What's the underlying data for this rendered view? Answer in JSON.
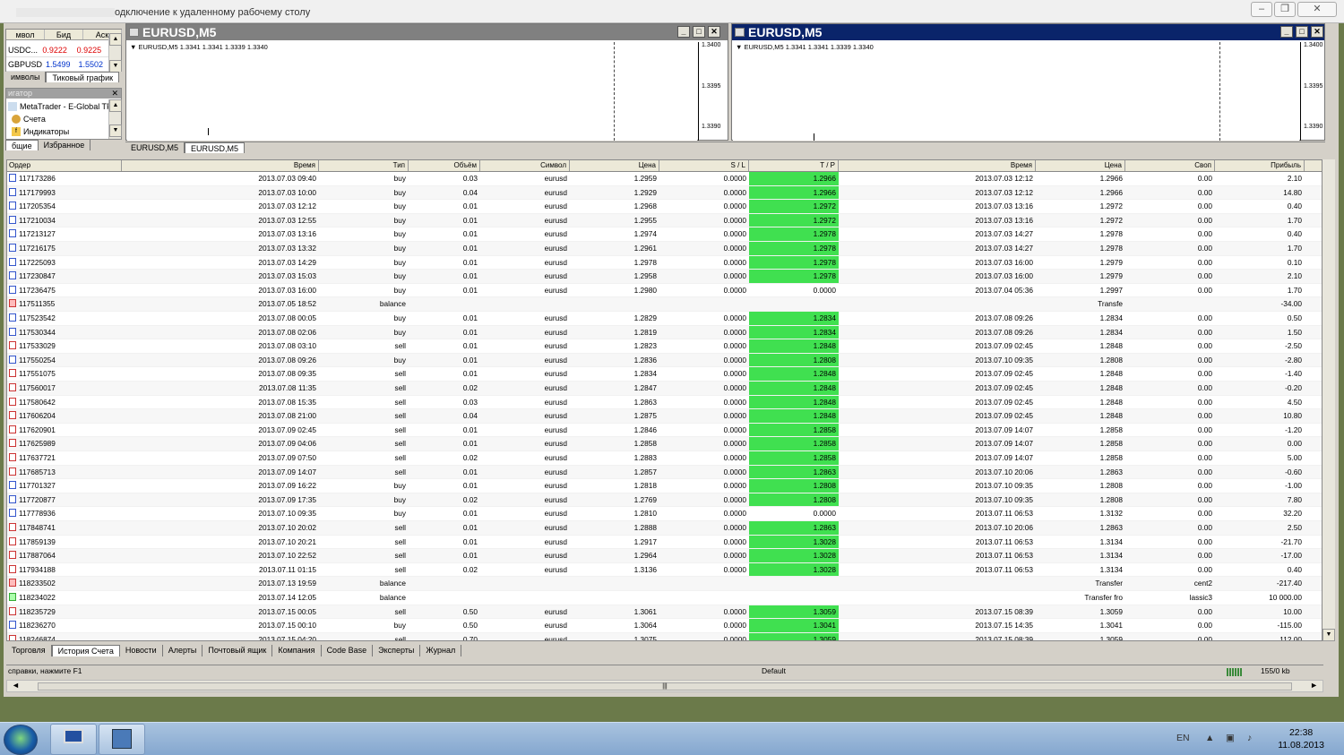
{
  "rdp": {
    "title": "одключение к удаленному рабочему столу"
  },
  "market_watch": {
    "headers": [
      "мвол",
      "Бид",
      "Аск"
    ],
    "rows": [
      {
        "symbol": "USDC...",
        "bid": "0.9222",
        "ask": "0.9225"
      },
      {
        "symbol": "GBPUSD",
        "bid": "1.5499",
        "ask": "1.5502"
      }
    ],
    "tabs": [
      "имволы",
      "Тиковый график"
    ]
  },
  "navigator": {
    "title": "игатор",
    "items": [
      "MetaTrader - E-Global TFG",
      "Счета",
      "Индикаторы"
    ],
    "tabs": [
      "бщие",
      "Избранное"
    ]
  },
  "charts": [
    {
      "title": "EURUSD,M5",
      "ohlc": "EURUSD,M5  1.3341 1.3341 1.3339 1.3340",
      "axis": [
        "1.3400",
        "1.3395",
        "1.3390"
      ]
    },
    {
      "title": "EURUSD,M5",
      "ohlc": "EURUSD,M5  1.3341 1.3341 1.3339 1.3340",
      "axis": [
        "1.3400",
        "1.3395",
        "1.3390"
      ]
    }
  ],
  "chart_tabs": [
    "EURUSD,M5",
    "EURUSD,M5"
  ],
  "table": {
    "headers": [
      "Ордер",
      "Время",
      "Тип",
      "Объём",
      "Символ",
      "Цена",
      "S / L",
      "T / P",
      "Время",
      "Цена",
      "Своп",
      "Прибыль"
    ],
    "rows": [
      [
        "117173286",
        "2013.07.03 09:40",
        "buy",
        "0.03",
        "eurusd",
        "1.2959",
        "0.0000",
        "1.2966",
        "2013.07.03 12:12",
        "1.2966",
        "0.00",
        "2.10"
      ],
      [
        "117179993",
        "2013.07.03 10:00",
        "buy",
        "0.04",
        "eurusd",
        "1.2929",
        "0.0000",
        "1.2966",
        "2013.07.03 12:12",
        "1.2966",
        "0.00",
        "14.80"
      ],
      [
        "117205354",
        "2013.07.03 12:12",
        "buy",
        "0.01",
        "eurusd",
        "1.2968",
        "0.0000",
        "1.2972",
        "2013.07.03 13:16",
        "1.2972",
        "0.00",
        "0.40"
      ],
      [
        "117210034",
        "2013.07.03 12:55",
        "buy",
        "0.01",
        "eurusd",
        "1.2955",
        "0.0000",
        "1.2972",
        "2013.07.03 13:16",
        "1.2972",
        "0.00",
        "1.70"
      ],
      [
        "117213127",
        "2013.07.03 13:16",
        "buy",
        "0.01",
        "eurusd",
        "1.2974",
        "0.0000",
        "1.2978",
        "2013.07.03 14:27",
        "1.2978",
        "0.00",
        "0.40"
      ],
      [
        "117216175",
        "2013.07.03 13:32",
        "buy",
        "0.01",
        "eurusd",
        "1.2961",
        "0.0000",
        "1.2978",
        "2013.07.03 14:27",
        "1.2978",
        "0.00",
        "1.70"
      ],
      [
        "117225093",
        "2013.07.03 14:29",
        "buy",
        "0.01",
        "eurusd",
        "1.2978",
        "0.0000",
        "1.2978",
        "2013.07.03 16:00",
        "1.2979",
        "0.00",
        "0.10"
      ],
      [
        "117230847",
        "2013.07.03 15:03",
        "buy",
        "0.01",
        "eurusd",
        "1.2958",
        "0.0000",
        "1.2978",
        "2013.07.03 16:00",
        "1.2979",
        "0.00",
        "2.10"
      ],
      [
        "117236475",
        "2013.07.03 16:00",
        "buy",
        "0.01",
        "eurusd",
        "1.2980",
        "0.0000",
        "0.0000",
        "2013.07.04 05:36",
        "1.2997",
        "0.00",
        "1.70"
      ],
      [
        "117511355",
        "2013.07.05 18:52",
        "balance",
        "",
        "",
        "",
        "",
        "",
        "",
        "Transfe",
        "",
        "-34.00"
      ],
      [
        "117523542",
        "2013.07.08 00:05",
        "buy",
        "0.01",
        "eurusd",
        "1.2829",
        "0.0000",
        "1.2834",
        "2013.07.08 09:26",
        "1.2834",
        "0.00",
        "0.50"
      ],
      [
        "117530344",
        "2013.07.08 02:06",
        "buy",
        "0.01",
        "eurusd",
        "1.2819",
        "0.0000",
        "1.2834",
        "2013.07.08 09:26",
        "1.2834",
        "0.00",
        "1.50"
      ],
      [
        "117533029",
        "2013.07.08 03:10",
        "sell",
        "0.01",
        "eurusd",
        "1.2823",
        "0.0000",
        "1.2848",
        "2013.07.09 02:45",
        "1.2848",
        "0.00",
        "-2.50"
      ],
      [
        "117550254",
        "2013.07.08 09:26",
        "buy",
        "0.01",
        "eurusd",
        "1.2836",
        "0.0000",
        "1.2808",
        "2013.07.10 09:35",
        "1.2808",
        "0.00",
        "-2.80"
      ],
      [
        "117551075",
        "2013.07.08 09:35",
        "sell",
        "0.01",
        "eurusd",
        "1.2834",
        "0.0000",
        "1.2848",
        "2013.07.09 02:45",
        "1.2848",
        "0.00",
        "-1.40"
      ],
      [
        "117560017",
        "2013.07.08 11:35",
        "sell",
        "0.02",
        "eurusd",
        "1.2847",
        "0.0000",
        "1.2848",
        "2013.07.09 02:45",
        "1.2848",
        "0.00",
        "-0.20"
      ],
      [
        "117580642",
        "2013.07.08 15:35",
        "sell",
        "0.03",
        "eurusd",
        "1.2863",
        "0.0000",
        "1.2848",
        "2013.07.09 02:45",
        "1.2848",
        "0.00",
        "4.50"
      ],
      [
        "117606204",
        "2013.07.08 21:00",
        "sell",
        "0.04",
        "eurusd",
        "1.2875",
        "0.0000",
        "1.2848",
        "2013.07.09 02:45",
        "1.2848",
        "0.00",
        "10.80"
      ],
      [
        "117620901",
        "2013.07.09 02:45",
        "sell",
        "0.01",
        "eurusd",
        "1.2846",
        "0.0000",
        "1.2858",
        "2013.07.09 14:07",
        "1.2858",
        "0.00",
        "-1.20"
      ],
      [
        "117625989",
        "2013.07.09 04:06",
        "sell",
        "0.01",
        "eurusd",
        "1.2858",
        "0.0000",
        "1.2858",
        "2013.07.09 14:07",
        "1.2858",
        "0.00",
        "0.00"
      ],
      [
        "117637721",
        "2013.07.09 07:50",
        "sell",
        "0.02",
        "eurusd",
        "1.2883",
        "0.0000",
        "1.2858",
        "2013.07.09 14:07",
        "1.2858",
        "0.00",
        "5.00"
      ],
      [
        "117685713",
        "2013.07.09 14:07",
        "sell",
        "0.01",
        "eurusd",
        "1.2857",
        "0.0000",
        "1.2863",
        "2013.07.10 20:06",
        "1.2863",
        "0.00",
        "-0.60"
      ],
      [
        "117701327",
        "2013.07.09 16:22",
        "buy",
        "0.01",
        "eurusd",
        "1.2818",
        "0.0000",
        "1.2808",
        "2013.07.10 09:35",
        "1.2808",
        "0.00",
        "-1.00"
      ],
      [
        "117720877",
        "2013.07.09 17:35",
        "buy",
        "0.02",
        "eurusd",
        "1.2769",
        "0.0000",
        "1.2808",
        "2013.07.10 09:35",
        "1.2808",
        "0.00",
        "7.80"
      ],
      [
        "117778936",
        "2013.07.10 09:35",
        "buy",
        "0.01",
        "eurusd",
        "1.2810",
        "0.0000",
        "0.0000",
        "2013.07.11 06:53",
        "1.3132",
        "0.00",
        "32.20"
      ],
      [
        "117848741",
        "2013.07.10 20:02",
        "sell",
        "0.01",
        "eurusd",
        "1.2888",
        "0.0000",
        "1.2863",
        "2013.07.10 20:06",
        "1.2863",
        "0.00",
        "2.50"
      ],
      [
        "117859139",
        "2013.07.10 20:21",
        "sell",
        "0.01",
        "eurusd",
        "1.2917",
        "0.0000",
        "1.3028",
        "2013.07.11 06:53",
        "1.3134",
        "0.00",
        "-21.70"
      ],
      [
        "117887064",
        "2013.07.10 22:52",
        "sell",
        "0.01",
        "eurusd",
        "1.2964",
        "0.0000",
        "1.3028",
        "2013.07.11 06:53",
        "1.3134",
        "0.00",
        "-17.00"
      ],
      [
        "117934188",
        "2013.07.11 01:15",
        "sell",
        "0.02",
        "eurusd",
        "1.3136",
        "0.0000",
        "1.3028",
        "2013.07.11 06:53",
        "1.3134",
        "0.00",
        "0.40"
      ],
      [
        "118233502",
        "2013.07.13 19:59",
        "balance",
        "",
        "",
        "",
        "",
        "",
        "",
        "Transfer",
        "cent2",
        "-217.40"
      ],
      [
        "118234022",
        "2013.07.14 12:05",
        "balance",
        "",
        "",
        "",
        "",
        "",
        "",
        "Transfer fro",
        "lassic3",
        "10 000.00"
      ],
      [
        "118235729",
        "2013.07.15 00:05",
        "sell",
        "0.50",
        "eurusd",
        "1.3061",
        "0.0000",
        "1.3059",
        "2013.07.15 08:39",
        "1.3059",
        "0.00",
        "10.00"
      ],
      [
        "118236270",
        "2013.07.15 00:10",
        "buy",
        "0.50",
        "eurusd",
        "1.3064",
        "0.0000",
        "1.3041",
        "2013.07.15 14:35",
        "1.3041",
        "0.00",
        "-115.00"
      ],
      [
        "118246874",
        "2013.07.15 04:20",
        "sell",
        "0.70",
        "eurusd",
        "1.3075",
        "0.0000",
        "1.3059",
        "2013.07.15 08:39",
        "1.3059",
        "0.00",
        "112.00"
      ]
    ]
  },
  "terminal_tabs": [
    "Торговля",
    "История Счета",
    "Новости",
    "Алерты",
    "Почтовый ящик",
    "Компания",
    "Code Base",
    "Эксперты",
    "Журнал"
  ],
  "status": {
    "help": "справки, нажмите F1",
    "profile": "Default",
    "traffic": "155/0 kb"
  },
  "taskbar": {
    "lang": "EN",
    "time": "22:38",
    "date": "11.08.2013"
  },
  "colors": {
    "tp_highlight": "#40e050",
    "active_title": "#0a246a",
    "inactive_title": "#808080"
  }
}
